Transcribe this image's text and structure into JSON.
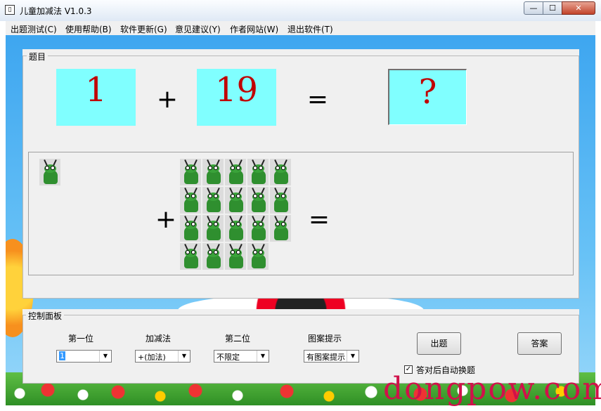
{
  "window": {
    "title": "儿童加减法 V1.0.3",
    "min_glyph": "—",
    "max_glyph": "☐",
    "close_glyph": "✕"
  },
  "menu": [
    "出题测试(C)",
    "使用帮助(B)",
    "软件更新(G)",
    "意见建议(Y)",
    "作者网站(W)",
    "退出软件(T)"
  ],
  "question": {
    "legend": "题目",
    "first": "1",
    "operator": "+",
    "second": "19",
    "equals": "=",
    "answer": "?"
  },
  "picture": {
    "operator": "+",
    "equals": "=",
    "first_count": 1,
    "second_count": 19,
    "icon": "grasshopper-icon"
  },
  "control": {
    "legend": "控制面板",
    "first_label": "第一位",
    "op_label": "加减法",
    "second_label": "第二位",
    "hint_label": "图案提示",
    "first_value": "1",
    "op_value": "+(加法)",
    "second_value": "不限定",
    "hint_value": "有图案提示",
    "generate_button": "出题",
    "answer_button": "答案",
    "auto_label": "答对后自动换题",
    "auto_checked": true
  },
  "watermark": "dongpow.com"
}
